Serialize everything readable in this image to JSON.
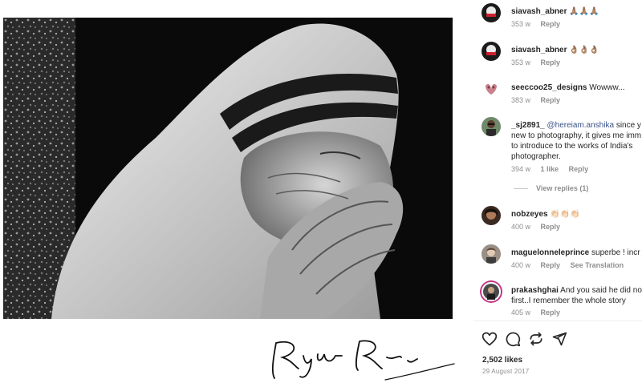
{
  "comments": [
    {
      "user": "siavash_abner",
      "text": "🙏🏽🙏🏽🙏🏽",
      "time": "353 w",
      "reply": "Reply"
    },
    {
      "user": "siavash_abner",
      "text": "👌🏽👌🏽👌🏽",
      "time": "353 w",
      "reply": "Reply"
    },
    {
      "user": "seeccoo25_designs",
      "text": "Wowww...",
      "time": "383 w",
      "reply": "Reply"
    },
    {
      "user": "_sj2891_",
      "mention": "@hereiam.anshika",
      "text_line1": "since y",
      "text_line2": "new to photography, it gives me imm",
      "text_line3": "to introduce to the works of India's",
      "text_line4": "photographer.",
      "time": "394 w",
      "likes": "1 like",
      "reply": "Reply",
      "view_replies": "View replies (1)"
    },
    {
      "user": "nobzeyes",
      "text": "👏🏻👏🏻👏🏻",
      "time": "400 w",
      "reply": "Reply"
    },
    {
      "user": "maguelonneleprince",
      "text": "superbe ! incr",
      "time": "400 w",
      "reply": "Reply",
      "translate": "See Translation"
    },
    {
      "user": "prakashghai",
      "text_line1": "And you said he did no",
      "text_line2": "first..I remember the whole story",
      "time": "405 w",
      "reply": "Reply"
    }
  ],
  "actions": {
    "like_icon": "heart-icon",
    "comment_icon": "comment-icon",
    "share_icon": "share-icon",
    "send_icon": "send-icon"
  },
  "likes": "2,502 likes",
  "date": "29 August 2017"
}
